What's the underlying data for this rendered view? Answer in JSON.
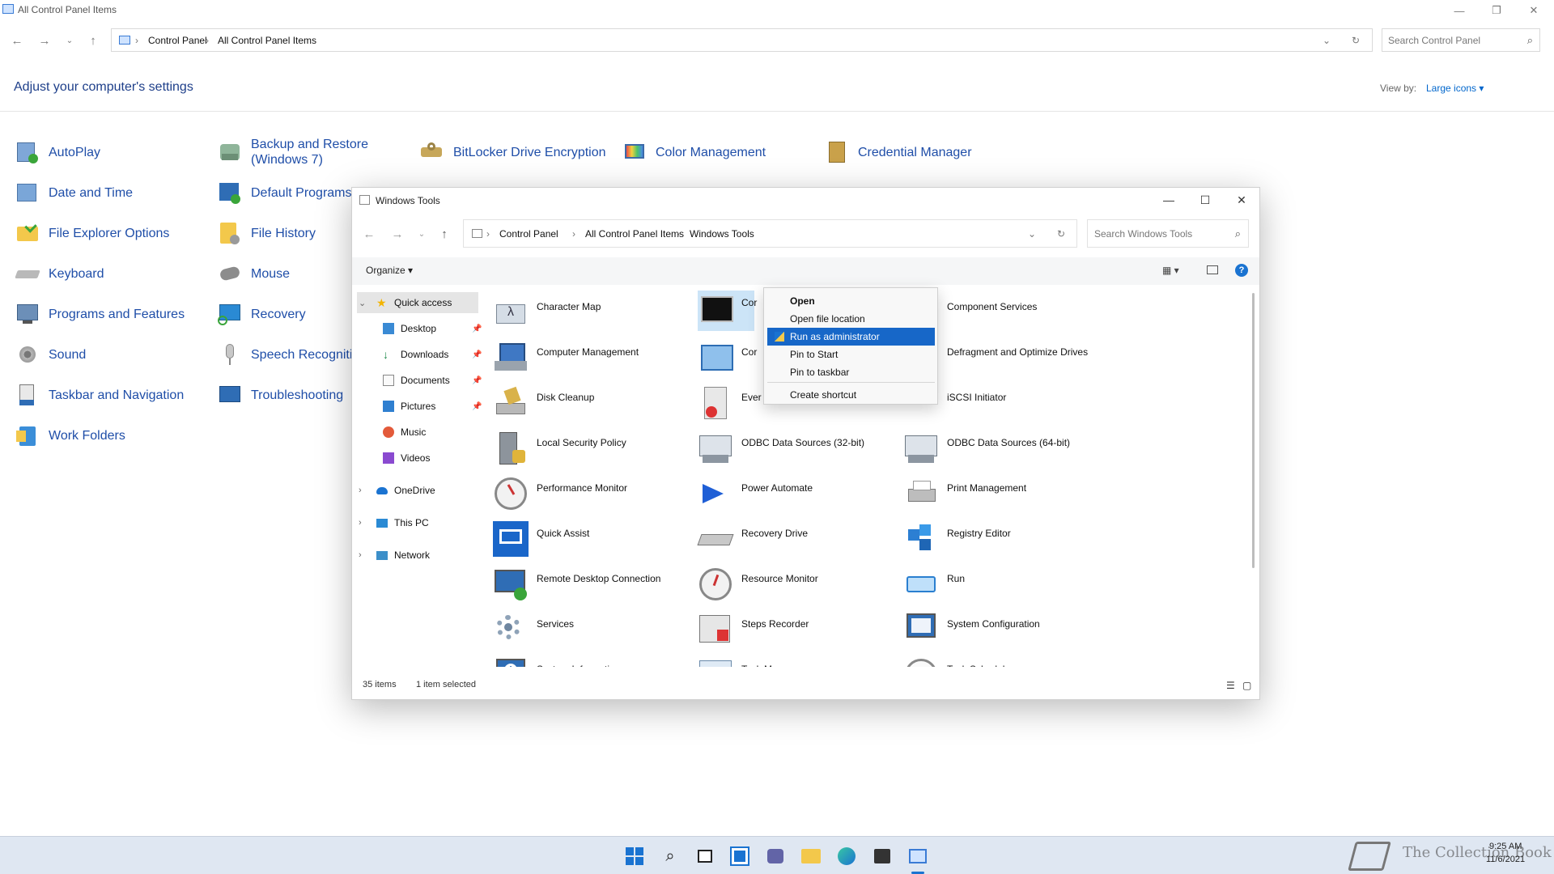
{
  "main_window": {
    "title": "All Control Panel Items",
    "breadcrumb": [
      "Control Panel",
      "All Control Panel Items"
    ],
    "search_placeholder": "Search Control Panel",
    "heading": "Adjust your computer's settings",
    "view_by_label": "View by:",
    "view_by_value": "Large icons ▾",
    "items": [
      {
        "label": "AutoPlay",
        "icon": "autoplay-icon"
      },
      {
        "label": "Backup and Restore (Windows 7)",
        "icon": "backup-icon"
      },
      {
        "label": "BitLocker Drive Encryption",
        "icon": "bitlocker-icon"
      },
      {
        "label": "Color Management",
        "icon": "color-management-icon"
      },
      {
        "label": "Credential Manager",
        "icon": "credential-manager-icon"
      },
      {
        "label": "Date and Time",
        "icon": "clock-icon"
      },
      {
        "label": "Default Programs",
        "icon": "default-programs-icon"
      },
      {
        "label": "File Explorer Options",
        "icon": "folder-options-icon"
      },
      {
        "label": "File History",
        "icon": "file-history-icon"
      },
      {
        "label": "Keyboard",
        "icon": "keyboard-icon"
      },
      {
        "label": "Mouse",
        "icon": "mouse-icon"
      },
      {
        "label": "Programs and Features",
        "icon": "programs-icon"
      },
      {
        "label": "Recovery",
        "icon": "recovery-icon"
      },
      {
        "label": "Sound",
        "icon": "speaker-icon"
      },
      {
        "label": "Speech Recogniti",
        "icon": "microphone-icon"
      },
      {
        "label": "Taskbar and Navigation",
        "icon": "taskbar-icon"
      },
      {
        "label": "Troubleshooting",
        "icon": "troubleshooting-icon"
      },
      {
        "label": "Work Folders",
        "icon": "work-folders-icon"
      }
    ]
  },
  "tools_window": {
    "title": "Windows Tools",
    "breadcrumb": [
      "Control Panel",
      "All Control Panel Items",
      "Windows Tools"
    ],
    "search_placeholder": "Search Windows Tools",
    "organize_label": "Organize ▾",
    "nav": {
      "quick_access": "Quick access",
      "pinned": [
        "Desktop",
        "Downloads",
        "Documents",
        "Pictures"
      ],
      "unpinned": [
        "Music",
        "Videos"
      ],
      "onedrive": "OneDrive",
      "this_pc": "This PC",
      "network": "Network"
    },
    "tools": [
      "Character Map",
      "Cor",
      "Component Services",
      "Computer Management",
      "Cor",
      "Defragment and Optimize Drives",
      "Disk Cleanup",
      "Ever",
      "iSCSI Initiator",
      "Local Security Policy",
      "ODBC Data Sources (32-bit)",
      "ODBC Data Sources (64-bit)",
      "Performance Monitor",
      "Power Automate",
      "Print Management",
      "Quick Assist",
      "Recovery Drive",
      "Registry Editor",
      "Remote Desktop Connection",
      "Resource Monitor",
      "Run",
      "Services",
      "Steps Recorder",
      "System Configuration",
      "System Information",
      "Task Manager",
      "Task Scheduler"
    ],
    "status_count": "35 items",
    "status_selected": "1 item selected"
  },
  "context_menu": {
    "items": [
      "Open",
      "Open file location",
      "Run as administrator",
      "Pin to Start",
      "Pin to taskbar",
      "Create shortcut"
    ],
    "selected": "Run as administrator"
  },
  "taskbar": {
    "time": "9:25 AM",
    "date": "11/6/2021",
    "watermark": "The Collection Book"
  },
  "colors": {
    "accent": "#1767c8",
    "link": "#1f4ea8",
    "heading": "#1e3f8a"
  }
}
